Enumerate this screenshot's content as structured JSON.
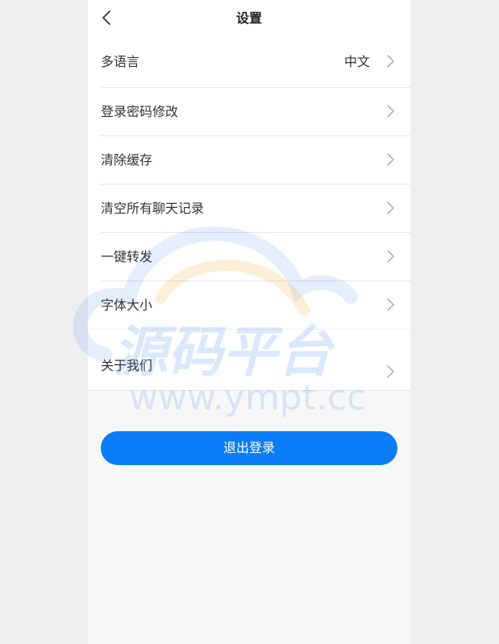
{
  "header": {
    "title": "设置"
  },
  "settings": {
    "items": [
      {
        "label": "多语言",
        "value": "中文"
      },
      {
        "label": "登录密码修改"
      },
      {
        "label": "清除缓存"
      },
      {
        "label": "清空所有聊天记录"
      },
      {
        "label": "一键转发"
      },
      {
        "label": "字体大小"
      }
    ],
    "about": {
      "label": "关于我们"
    }
  },
  "logout": {
    "label": "退出登录"
  },
  "watermark": {
    "title": "源码平台",
    "url": "www.ympt.cc"
  },
  "colors": {
    "accent": "#0a7cf7",
    "background": "#f7f7f7"
  }
}
